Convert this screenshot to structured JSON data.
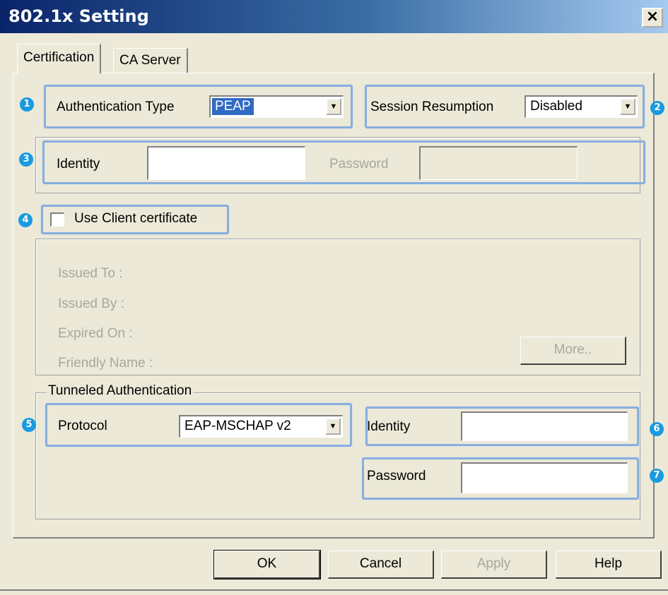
{
  "window": {
    "title": "802.1x Setting",
    "close_glyph": "×"
  },
  "tabs": [
    {
      "label": "Certification",
      "active": true
    },
    {
      "label": "CA Server",
      "active": false
    }
  ],
  "badges": [
    "1",
    "2",
    "3",
    "4",
    "5",
    "6",
    "7"
  ],
  "auth": {
    "label": "Authentication Type",
    "value": "PEAP"
  },
  "session": {
    "label": "Session Resumption",
    "value": "Disabled"
  },
  "credentials": {
    "identity_label": "Identity",
    "identity_value": "",
    "password_label": "Password",
    "password_value": ""
  },
  "client_cert": {
    "checkbox_label": "Use Client certificate",
    "checked": false,
    "fields": [
      "Issued To :",
      "Issued By :",
      "Expired On :",
      "Friendly Name :"
    ],
    "more_button": "More.."
  },
  "tunneled": {
    "legend": "Tunneled Authentication",
    "protocol_label": "Protocol",
    "protocol_value": "EAP-MSCHAP v2",
    "identity_label": "Identity",
    "identity_value": "",
    "password_label": "Password",
    "password_value": ""
  },
  "buttons": {
    "ok": "OK",
    "cancel": "Cancel",
    "apply": "Apply",
    "help": "Help"
  },
  "colors": {
    "highlight": "#88aede",
    "badge": "#1a9ae0",
    "selection": "#316ac5"
  }
}
